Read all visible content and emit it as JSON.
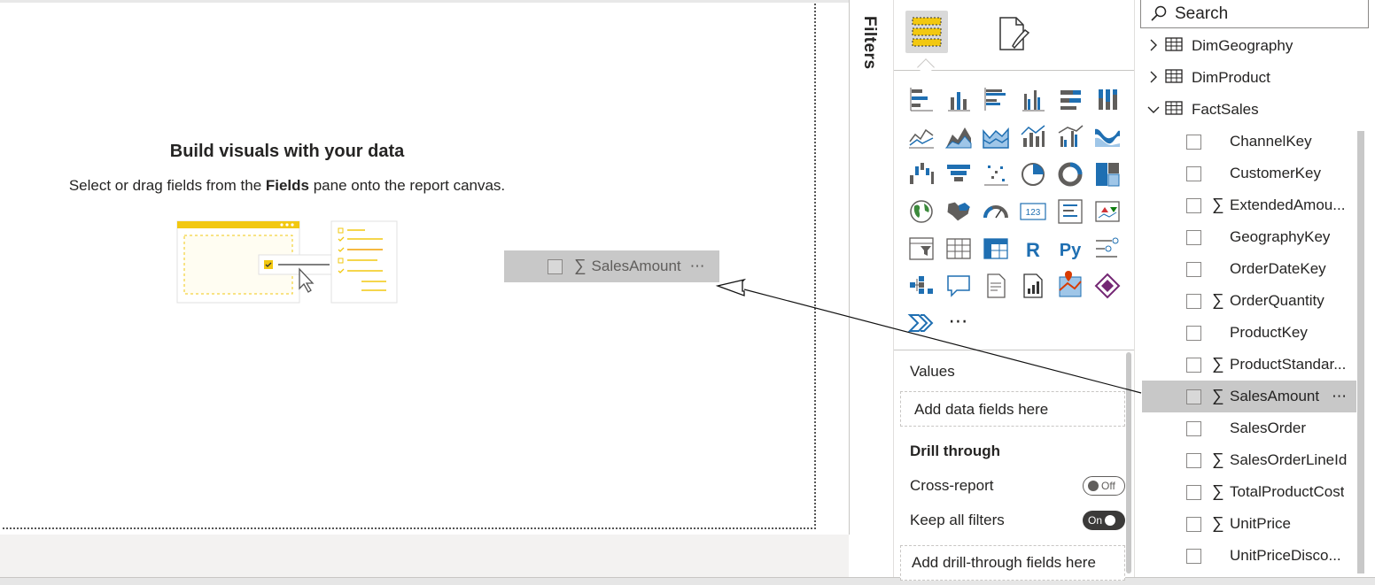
{
  "canvas": {
    "empty_title": "Build visuals with your data",
    "empty_sub_pre": "Select or drag fields from the ",
    "empty_sub_bold": "Fields",
    "empty_sub_post": " pane onto the report canvas.",
    "drag_ghost": {
      "sigma": "∑",
      "label": "SalesAmount",
      "more": "⋯"
    }
  },
  "filters": {
    "label": "Filters"
  },
  "visualizations": {
    "tabs": [
      {
        "name": "build-visual-tab",
        "icon": "build-visual-icon",
        "selected": true
      },
      {
        "name": "format-visual-tab",
        "icon": "format-paintbrush-icon",
        "selected": false
      }
    ],
    "icons": [
      "stacked-bar-chart",
      "stacked-column-chart",
      "clustered-bar-chart",
      "clustered-column-chart",
      "100-stacked-bar-chart",
      "100-stacked-column-chart",
      "line-chart",
      "area-chart",
      "stacked-area-chart",
      "line-and-stacked-column-chart",
      "line-and-clustered-column-chart",
      "ribbon-chart",
      "waterfall-chart",
      "funnel-chart",
      "scatter-chart",
      "pie-chart",
      "donut-chart",
      "treemap",
      "map",
      "filled-map",
      "gauge",
      "card",
      "multi-row-card",
      "kpi",
      "slicer",
      "table",
      "matrix",
      "r-script-visual",
      "python-visual",
      "key-influencers",
      "decomposition-tree",
      "qa-visual",
      "smart-narrative",
      "paginated-report",
      "azure-map",
      "power-apps",
      "power-automate",
      "more-visuals"
    ],
    "r_label": "R",
    "py_label": "Py",
    "card_label": "123",
    "more_label": "⋯",
    "values_label": "Values",
    "values_placeholder": "Add data fields here",
    "drill_label": "Drill through",
    "cross_report_label": "Cross-report",
    "cross_report_state": "Off",
    "keep_filters_label": "Keep all filters",
    "keep_filters_state": "On",
    "drill_placeholder": "Add drill-through fields here"
  },
  "fields": {
    "search_placeholder": "Search",
    "tables": [
      {
        "name": "DimGeography",
        "expanded": false
      },
      {
        "name": "DimProduct",
        "expanded": false
      },
      {
        "name": "FactSales",
        "expanded": true
      }
    ],
    "items": [
      {
        "name": "ChannelKey",
        "sigma": ""
      },
      {
        "name": "CustomerKey",
        "sigma": ""
      },
      {
        "name": "ExtendedAmou...",
        "sigma": "∑"
      },
      {
        "name": "GeographyKey",
        "sigma": ""
      },
      {
        "name": "OrderDateKey",
        "sigma": ""
      },
      {
        "name": "OrderQuantity",
        "sigma": "∑"
      },
      {
        "name": "ProductKey",
        "sigma": ""
      },
      {
        "name": "ProductStandar...",
        "sigma": "∑"
      },
      {
        "name": "SalesAmount",
        "sigma": "∑",
        "more": "⋯"
      },
      {
        "name": "SalesOrder",
        "sigma": ""
      },
      {
        "name": "SalesOrderLineId",
        "sigma": "∑"
      },
      {
        "name": "TotalProductCost",
        "sigma": "∑"
      },
      {
        "name": "UnitPrice",
        "sigma": "∑"
      },
      {
        "name": "UnitPriceDisco...",
        "sigma": ""
      }
    ]
  },
  "colors": {
    "accent_yellow": "#f2c811",
    "icon_blue": "#1f6fb2",
    "icon_gray": "#605e5c"
  }
}
